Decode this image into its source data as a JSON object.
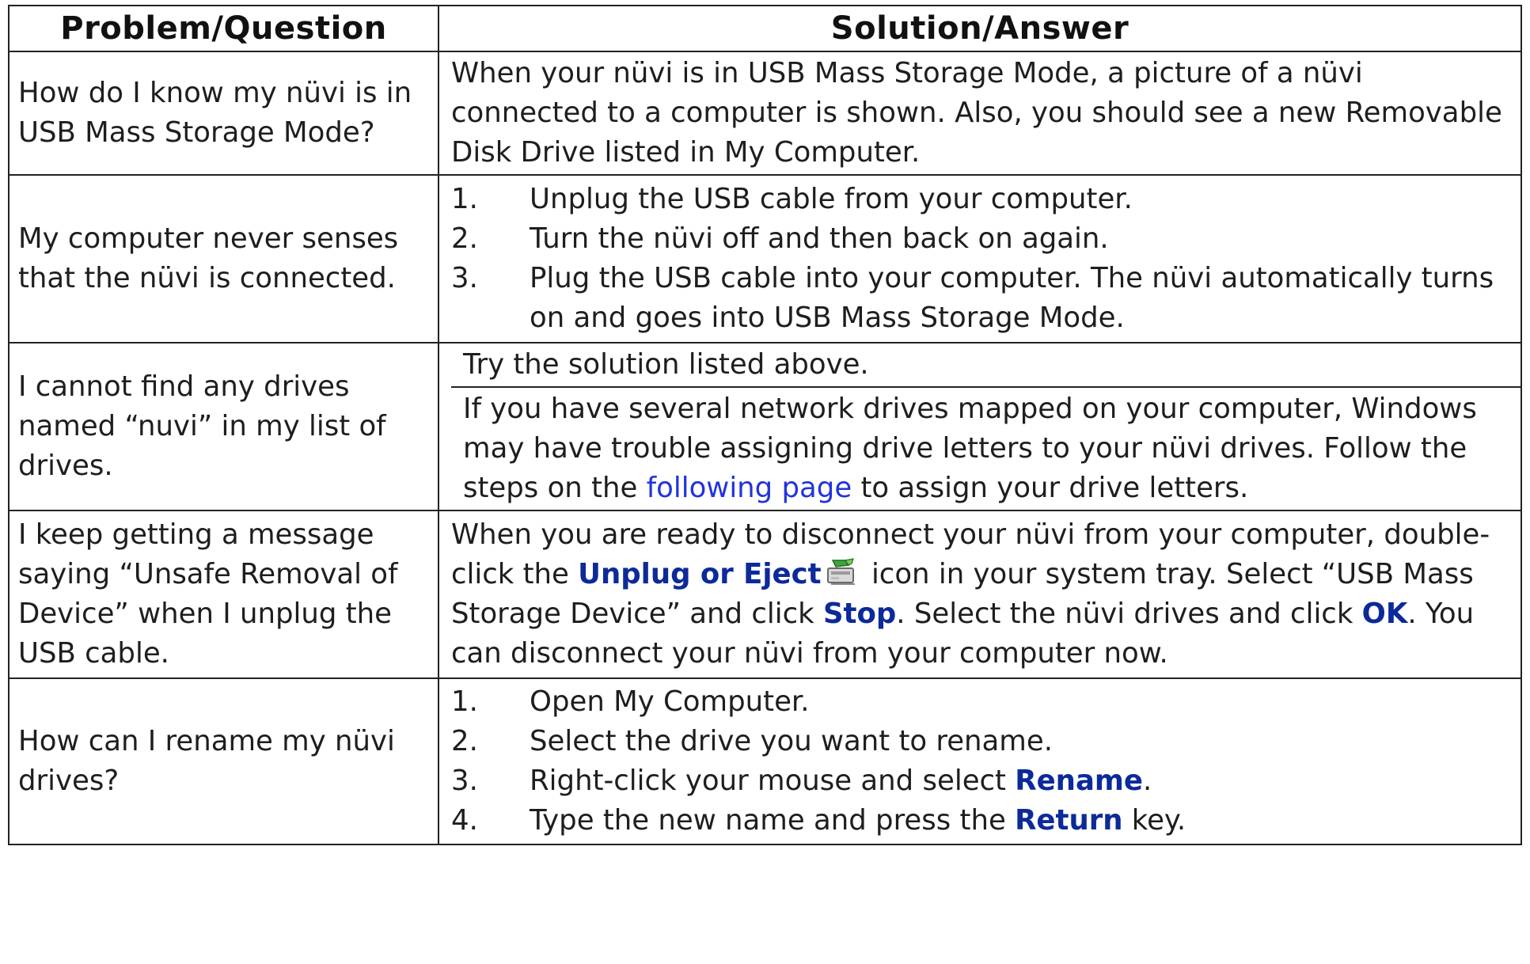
{
  "headers": {
    "problem": "Problem/Question",
    "solution": "Solution/Answer"
  },
  "rows": [
    {
      "question": "How do I know my nüvi is in USB Mass Storage Mode?",
      "answer": "When your nüvi is in USB Mass Storage Mode, a picture of a nüvi connected to a computer is shown. Also, you should see a new Removable Disk Drive listed in My Computer."
    },
    {
      "question": "My computer never senses that the nüvi is connected.",
      "steps": [
        {
          "num": "1.",
          "text": "Unplug the USB cable from your computer."
        },
        {
          "num": "2.",
          "text": "Turn the nüvi off and then back on again."
        },
        {
          "num": "3.",
          "text": "Plug the USB cable into your computer. The nüvi automatically turns on and goes into USB Mass Storage Mode."
        }
      ]
    },
    {
      "question": "I cannot find any drives named “nuvi” in my list of drives.",
      "answer_a": "Try the solution listed above.",
      "answer_b_pre": "If you have several network drives mapped on your computer, Windows may have trouble assigning drive letters to your nüvi drives. Follow the steps on the ",
      "answer_b_link": "following page",
      "answer_b_post": " to assign your drive letters."
    },
    {
      "question": "I keep getting a message saying “Unsafe Removal of Device” when I unplug the USB cable.",
      "p1": "When you are ready to disconnect your nüvi from your computer, double-click the ",
      "kw1": "Unplug or Eject",
      "p2": " icon in your system tray. Select “USB Mass Storage Device” and click ",
      "kw2": "Stop",
      "p3": ". Select the nüvi drives and click ",
      "kw3": "OK",
      "p4": ". You can disconnect your nüvi from your computer now.",
      "icon": "unplug-eject-icon"
    },
    {
      "question": "How can I rename my nüvi drives?",
      "steps": [
        {
          "num": "1.",
          "text": "Open My Computer."
        },
        {
          "num": "2.",
          "text": "Select the drive you want to rename."
        },
        {
          "num": "3.",
          "pre": "Right-click your mouse and select ",
          "kw": "Rename",
          "post": "."
        },
        {
          "num": "4.",
          "pre": "Type the new name and press the ",
          "kw": "Return",
          "post": " key."
        }
      ]
    }
  ],
  "colors": {
    "keyword": "#0c2a9a",
    "link": "#2233dd",
    "border": "#222222"
  }
}
